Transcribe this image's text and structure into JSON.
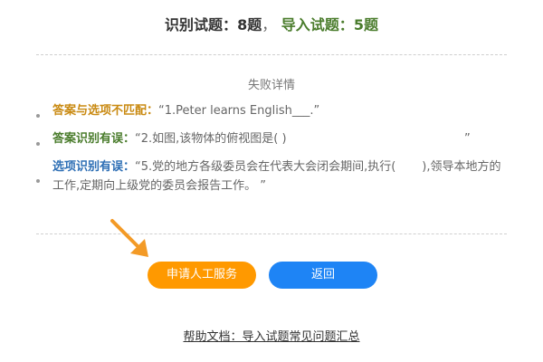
{
  "summary": {
    "recognized_label": "识别试题：",
    "recognized_count": "8题",
    "separator": "，",
    "imported_label": "导入试题：",
    "imported_count": "5题"
  },
  "failure": {
    "title": "失败详情",
    "items": [
      {
        "label": "答案与选项不匹配：",
        "text": "“1.Peter learns English___.”"
      },
      {
        "label": "答案识别有误：",
        "text": "“2.如图,该物体的俯视图是( )",
        "end_quote": "”"
      },
      {
        "label": "选项识别有误：",
        "text": "“5.党的地方各级委员会在代表大会闭会期间,执行(       ),领导本地方的工作,定期向上级党的委员会报告工作。 ”"
      }
    ]
  },
  "buttons": {
    "apply_service": "申请人工服务",
    "back": "返回"
  },
  "help": {
    "link_text": "帮助文档：导入试题常见问题汇总"
  },
  "colors": {
    "orange_button": "#ff9900",
    "blue_button": "#1e84f5",
    "green": "#4a7c2c",
    "orange_label": "#c98a12",
    "blue_label": "#2e6fb5"
  },
  "icons": {
    "pointer": "arrow-pointer-icon"
  }
}
